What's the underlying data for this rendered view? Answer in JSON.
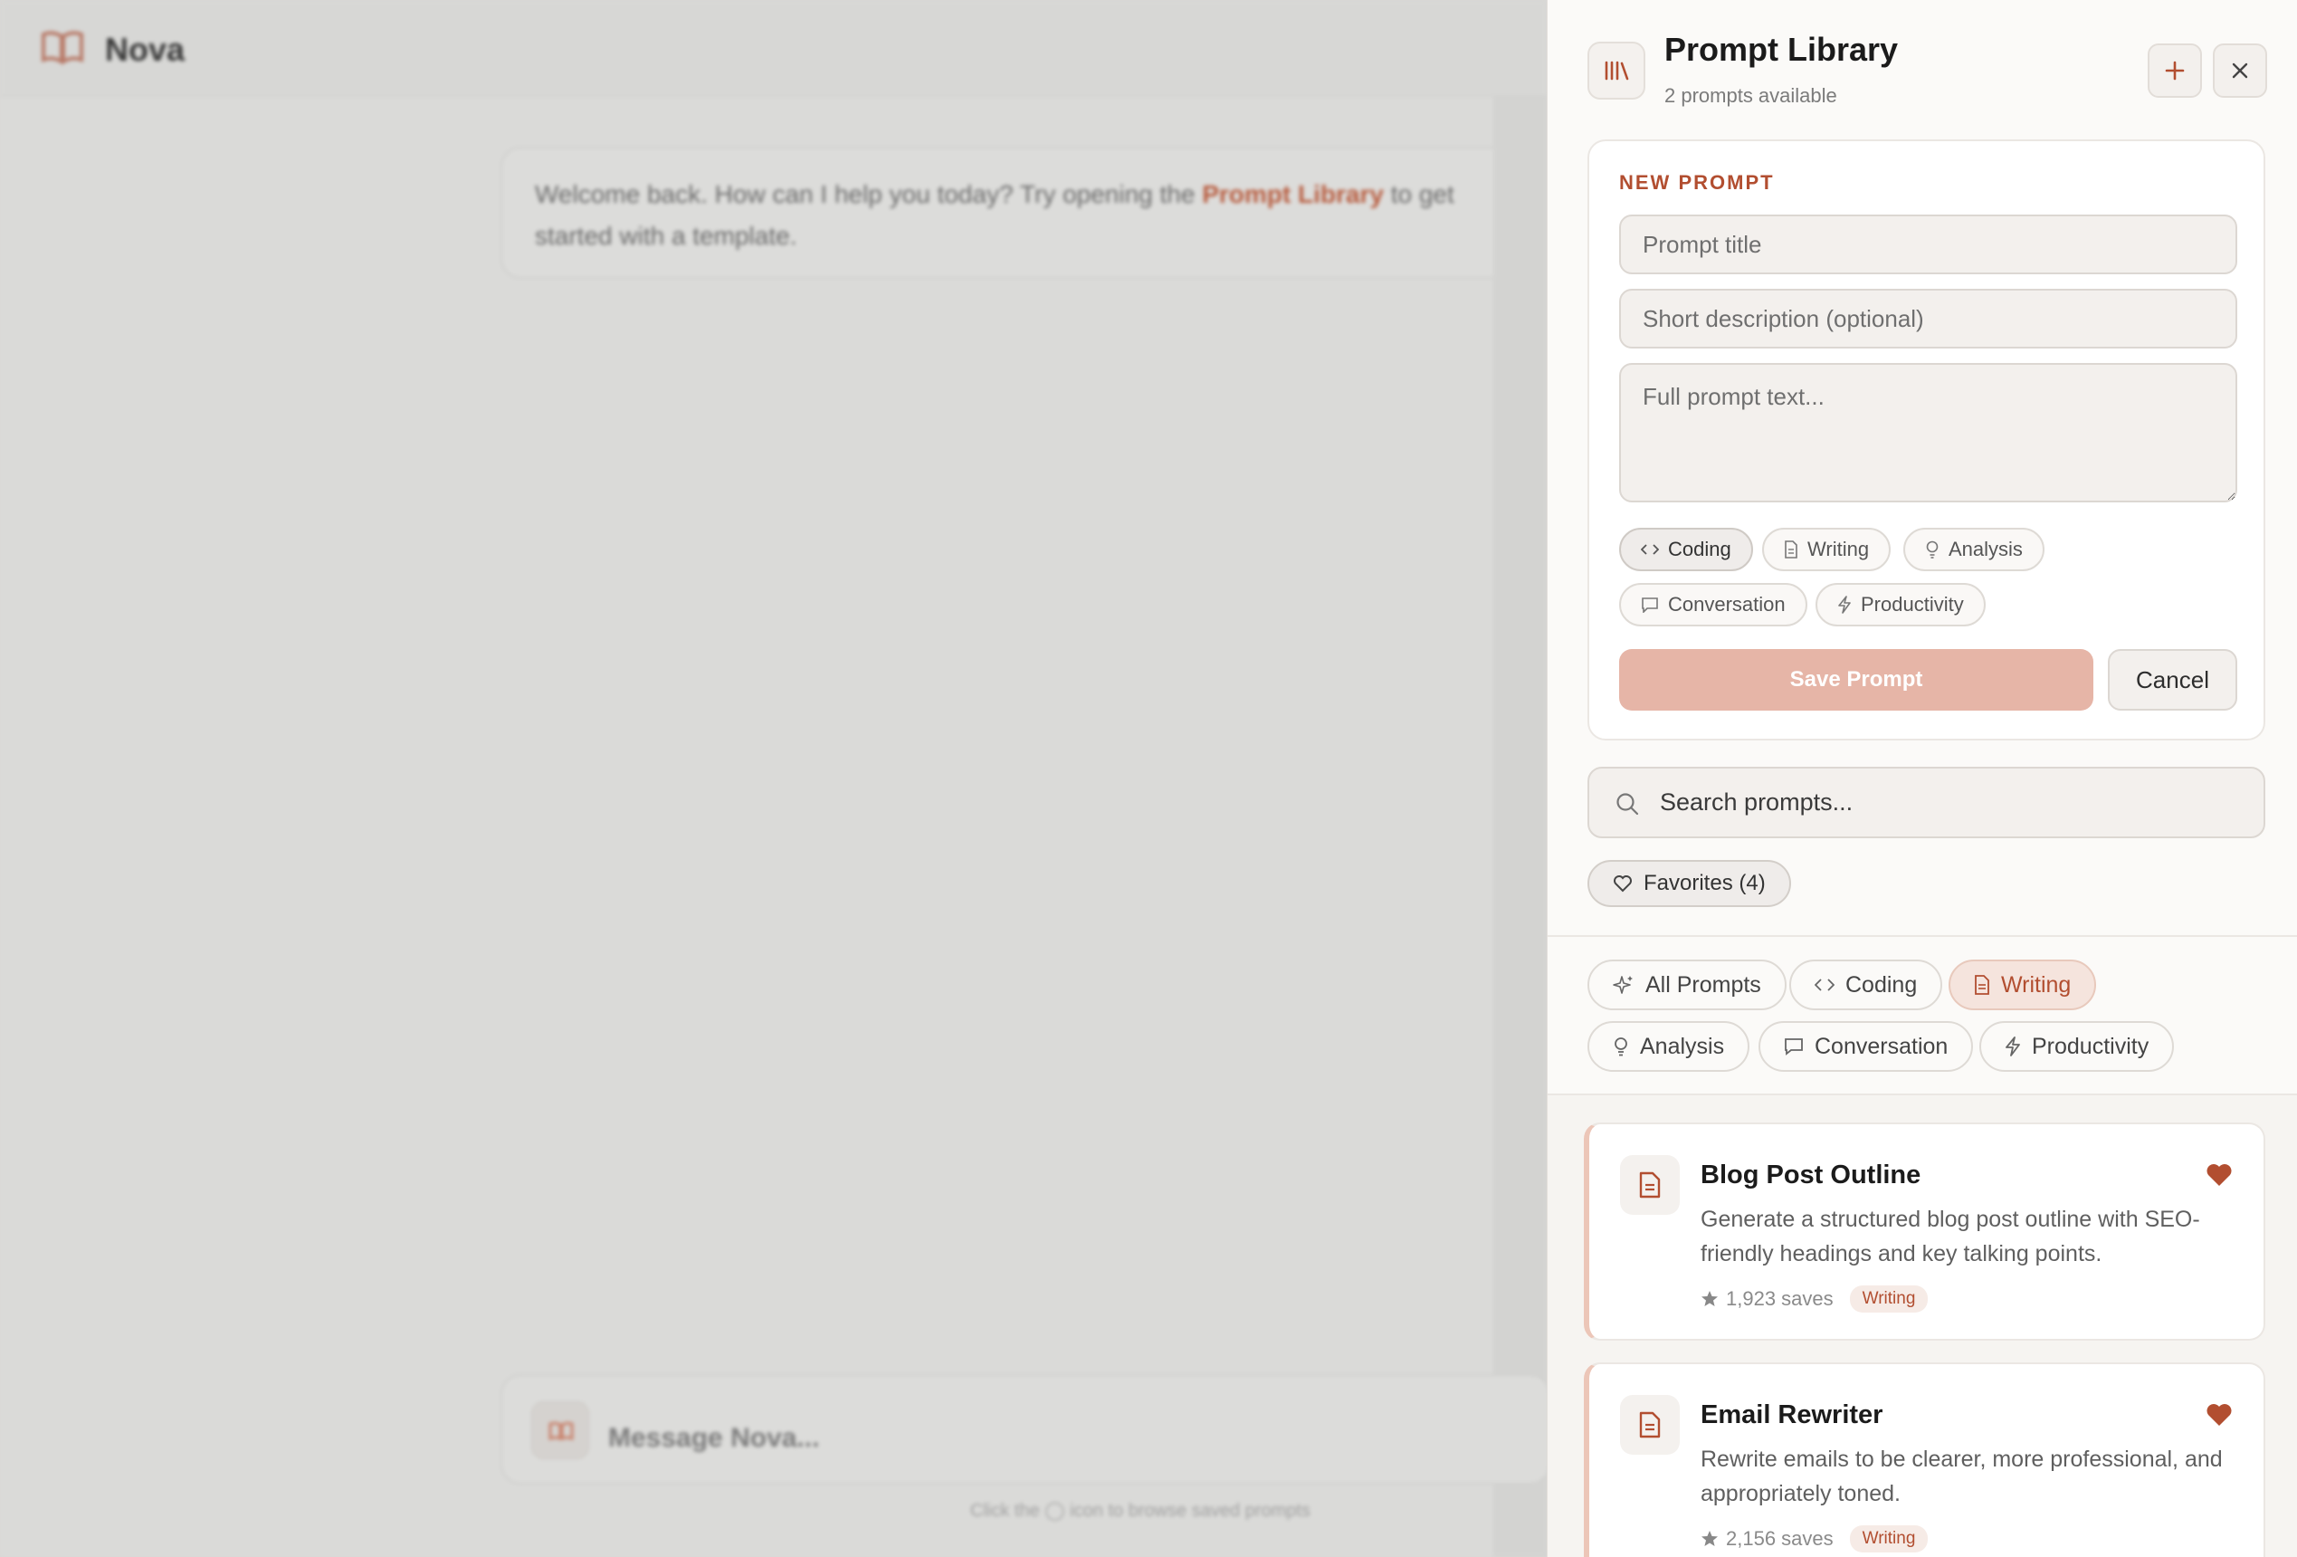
{
  "background": {
    "app_name": "Nova",
    "welcome_before": "Welcome back. How can I help you today? Try opening the ",
    "welcome_link": "Prompt Library",
    "welcome_after": " to get started with a template.",
    "composer_placeholder": "Message Nova...",
    "hint_before": "Click the",
    "hint_after": "icon to browse saved prompts"
  },
  "panel": {
    "title": "Prompt Library",
    "subtitle": "2 prompts available",
    "header_icon": "library-icon",
    "add_icon": "plus-icon",
    "close_icon": "close-icon"
  },
  "new_prompt": {
    "section_label": "NEW PROMPT",
    "title_placeholder": "Prompt title",
    "description_placeholder": "Short description (optional)",
    "text_placeholder": "Full prompt text...",
    "category_chips": [
      {
        "label": "Coding",
        "icon": "code-icon",
        "selected": true
      },
      {
        "label": "Writing",
        "icon": "document-icon",
        "selected": false
      },
      {
        "label": "Analysis",
        "icon": "lightbulb-icon",
        "selected": false
      },
      {
        "label": "Conversation",
        "icon": "chat-icon",
        "selected": false
      },
      {
        "label": "Productivity",
        "icon": "bolt-icon",
        "selected": false
      }
    ],
    "save_label": "Save Prompt",
    "cancel_label": "Cancel"
  },
  "search": {
    "placeholder": "Search prompts..."
  },
  "favorites_label": "Favorites (4)",
  "categories": [
    {
      "label": "All Prompts",
      "icon": "sparkle-icon",
      "active": false
    },
    {
      "label": "Coding",
      "icon": "code-icon",
      "active": false
    },
    {
      "label": "Writing",
      "icon": "document-icon",
      "active": true
    },
    {
      "label": "Analysis",
      "icon": "lightbulb-icon",
      "active": false
    },
    {
      "label": "Conversation",
      "icon": "chat-icon",
      "active": false
    },
    {
      "label": "Productivity",
      "icon": "bolt-icon",
      "active": false
    }
  ],
  "prompts": [
    {
      "title": "Blog Post Outline",
      "description": "Generate a structured blog post outline with SEO-friendly headings and key talking points.",
      "saves": "1,923 saves",
      "tag": "Writing",
      "favorited": true
    },
    {
      "title": "Email Rewriter",
      "description": "Rewrite emails to be clearer, more professional, and appropriately toned.",
      "saves": "2,156 saves",
      "tag": "Writing",
      "favorited": true
    }
  ],
  "colors": {
    "accent": "#b24e30",
    "save_button_disabled": "#e6b5a7",
    "active_chip_bg": "#f5e4dd",
    "favorite_heart": "#b24e30"
  }
}
